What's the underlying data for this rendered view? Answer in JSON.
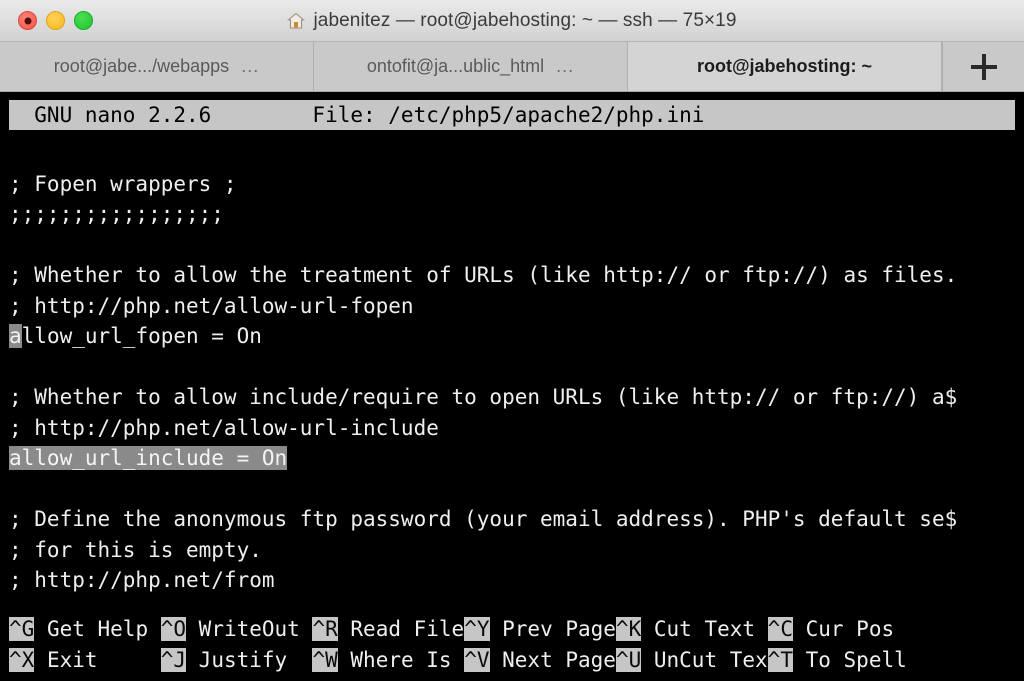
{
  "window": {
    "title": "jabenitez — root@jabehosting: ~ — ssh — 75×19",
    "home_icon": "home-icon",
    "traffic_lights": [
      {
        "name": "close",
        "color": "#f0564a"
      },
      {
        "name": "minimize",
        "color": "#f5b71f"
      },
      {
        "name": "maximize",
        "color": "#1cc430"
      }
    ]
  },
  "tabs": {
    "items": [
      {
        "label": "root@jabe.../webapps",
        "dots": "...",
        "active": false
      },
      {
        "label": "ontofit@ja...ublic_html",
        "dots": "...",
        "active": false
      },
      {
        "label": "root@jabehosting: ~",
        "dots": "",
        "active": true
      }
    ],
    "new_tab_label": "+"
  },
  "terminal": {
    "nano_header": "  GNU nano 2.2.6        File: /etc/php5/apache2/php.ini",
    "lines": [
      {
        "segments": [
          {
            "text": ""
          }
        ]
      },
      {
        "segments": [
          {
            "text": "; Fopen wrappers ;"
          }
        ]
      },
      {
        "segments": [
          {
            "text": ";;;;;;;;;;;;;;;;;"
          }
        ]
      },
      {
        "segments": [
          {
            "text": ""
          }
        ]
      },
      {
        "segments": [
          {
            "text": "; Whether to allow the treatment of URLs (like http:// or ftp://) as files."
          }
        ]
      },
      {
        "segments": [
          {
            "text": "; http://php.net/allow-url-fopen"
          }
        ]
      },
      {
        "segments": [
          {
            "text": "a",
            "style": "cursor"
          },
          {
            "text": "llow_url_fopen = On"
          }
        ]
      },
      {
        "segments": [
          {
            "text": ""
          }
        ]
      },
      {
        "segments": [
          {
            "text": "; Whether to allow include/require to open URLs (like http:// or ftp://) a$"
          }
        ]
      },
      {
        "segments": [
          {
            "text": "; http://php.net/allow-url-include"
          }
        ]
      },
      {
        "segments": [
          {
            "text": "allow_url_include = On",
            "style": "sel"
          }
        ]
      },
      {
        "segments": [
          {
            "text": ""
          }
        ]
      },
      {
        "segments": [
          {
            "text": "; Define the anonymous ftp password (your email address). PHP's default se$"
          }
        ]
      },
      {
        "segments": [
          {
            "text": "; for this is empty."
          }
        ]
      },
      {
        "segments": [
          {
            "text": "; http://php.net/from"
          }
        ]
      }
    ],
    "shortcuts": {
      "row1": [
        {
          "key": "^G",
          "label": " Get Help "
        },
        {
          "key": "^O",
          "label": " WriteOut "
        },
        {
          "key": "^R",
          "label": " Read File"
        },
        {
          "key": "^Y",
          "label": " Prev Page"
        },
        {
          "key": "^K",
          "label": " Cut Text "
        },
        {
          "key": "^C",
          "label": " Cur Pos"
        }
      ],
      "row2": [
        {
          "key": "^X",
          "label": " Exit     "
        },
        {
          "key": "^J",
          "label": " Justify  "
        },
        {
          "key": "^W",
          "label": " Where Is "
        },
        {
          "key": "^V",
          "label": " Next Page"
        },
        {
          "key": "^U",
          "label": " UnCut Tex"
        },
        {
          "key": "^T",
          "label": " To Spell"
        }
      ]
    }
  }
}
